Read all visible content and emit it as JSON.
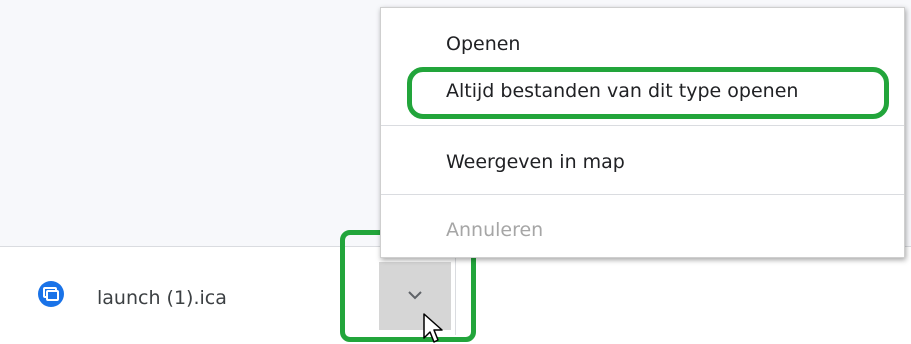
{
  "download": {
    "file_name": "launch (1).ica",
    "file_icon": "citrix-receiver-icon",
    "menu_button_icon": "chevron-down-icon"
  },
  "context_menu": {
    "items": [
      {
        "label": "Openen",
        "enabled": true
      },
      {
        "label": "Altijd bestanden van dit type openen",
        "enabled": true,
        "highlighted": true
      },
      {
        "label": "Weergeven in map",
        "enabled": true
      },
      {
        "label": "Annuleren",
        "enabled": false
      }
    ]
  },
  "annotations": {
    "highlight_color": "#22a53b"
  },
  "cursor": "pointer-cursor-icon"
}
